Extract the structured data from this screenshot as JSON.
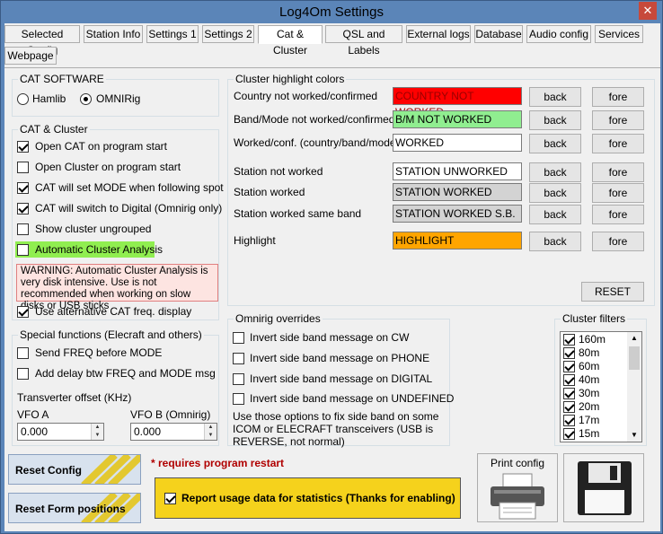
{
  "window": {
    "title": "Log4Om Settings",
    "close_label": "✕"
  },
  "tabs": [
    "Selected Config",
    "Station Info",
    "Settings 1",
    "Settings 2",
    "Cat & Cluster",
    "QSL and Labels",
    "External logs",
    "Database",
    "Audio config",
    "Services",
    "Webpage"
  ],
  "cat_software": {
    "title": "CAT SOFTWARE",
    "hamlib": "Hamlib",
    "omnirig": "OMNIRig"
  },
  "cat_cluster": {
    "title": "CAT & Cluster",
    "items": [
      {
        "label": "Open CAT on program start",
        "checked": true
      },
      {
        "label": "Open Cluster on program start",
        "checked": false
      },
      {
        "label": "CAT will set MODE when following spot",
        "checked": true
      },
      {
        "label": "CAT will switch to Digital (Omnirig only)",
        "checked": true
      },
      {
        "label": "Show cluster ungrouped",
        "checked": false
      },
      {
        "label": "Automatic Cluster Analysis",
        "checked": false
      }
    ],
    "warning": "WARNING: Automatic Cluster Analysis is very disk intensive. Use is not recommended when working on slow disks or USB sticks",
    "alt_freq": {
      "label": "Use alternative CAT freq. display",
      "checked": true
    }
  },
  "special": {
    "title": "Special functions (Elecraft and others)",
    "send_freq": "Send FREQ before MODE",
    "add_delay": "Add delay btw FREQ and MODE msg",
    "transverter": "Transverter offset (KHz)",
    "vfo_a": "VFO A",
    "vfo_b": "VFO B (Omnirig)",
    "vfo_a_value": "0.000",
    "vfo_b_value": "0.000"
  },
  "highlight": {
    "title": "Cluster highlight colors",
    "back": "back",
    "fore": "fore",
    "reset": "RESET",
    "rows": [
      {
        "label": "Country not worked/confirmed",
        "value": "COUNTRY NOT WORKED",
        "bg": "#ff0000",
        "fg": "#990000"
      },
      {
        "label": "Band/Mode not worked/confirmed",
        "value": "B/M NOT WORKED",
        "bg": "#90ee90",
        "fg": "#000000"
      },
      {
        "label": "Worked/conf. (country/band/mode)",
        "value": "WORKED",
        "bg": "#ffffff",
        "fg": "#000000"
      },
      {
        "label": "Station not worked",
        "value": "STATION UNWORKED",
        "bg": "#ffffff",
        "fg": "#000000"
      },
      {
        "label": "Station worked",
        "value": "STATION WORKED",
        "bg": "#d3d3d3",
        "fg": "#000000"
      },
      {
        "label": "Station worked same band",
        "value": "STATION WORKED S.B.",
        "bg": "#d3d3d3",
        "fg": "#000000"
      },
      {
        "label": "Highlight",
        "value": "HIGHLIGHT",
        "bg": "#ffa500",
        "fg": "#000000"
      }
    ]
  },
  "omnirig": {
    "title": "Omnirig overrides",
    "items": [
      "Invert side band message on CW",
      "Invert side band message on PHONE",
      "Invert side band message on DIGITAL",
      "Invert side band message on UNDEFINED"
    ],
    "note": "Use those options to fix side band on some ICOM or ELECRAFT transceivers (USB is REVERSE, not normal)"
  },
  "filters": {
    "title": "Cluster filters",
    "items": [
      "160m",
      "80m",
      "60m",
      "40m",
      "30m",
      "20m",
      "17m",
      "15m"
    ]
  },
  "buttons": {
    "reset_config": "Reset Config",
    "reset_form": "Reset Form positions",
    "print_config": "Print config"
  },
  "restart_note": "* requires program restart",
  "usage": {
    "label": "Report usage data for statistics (Thanks for enabling)",
    "checked": true
  }
}
